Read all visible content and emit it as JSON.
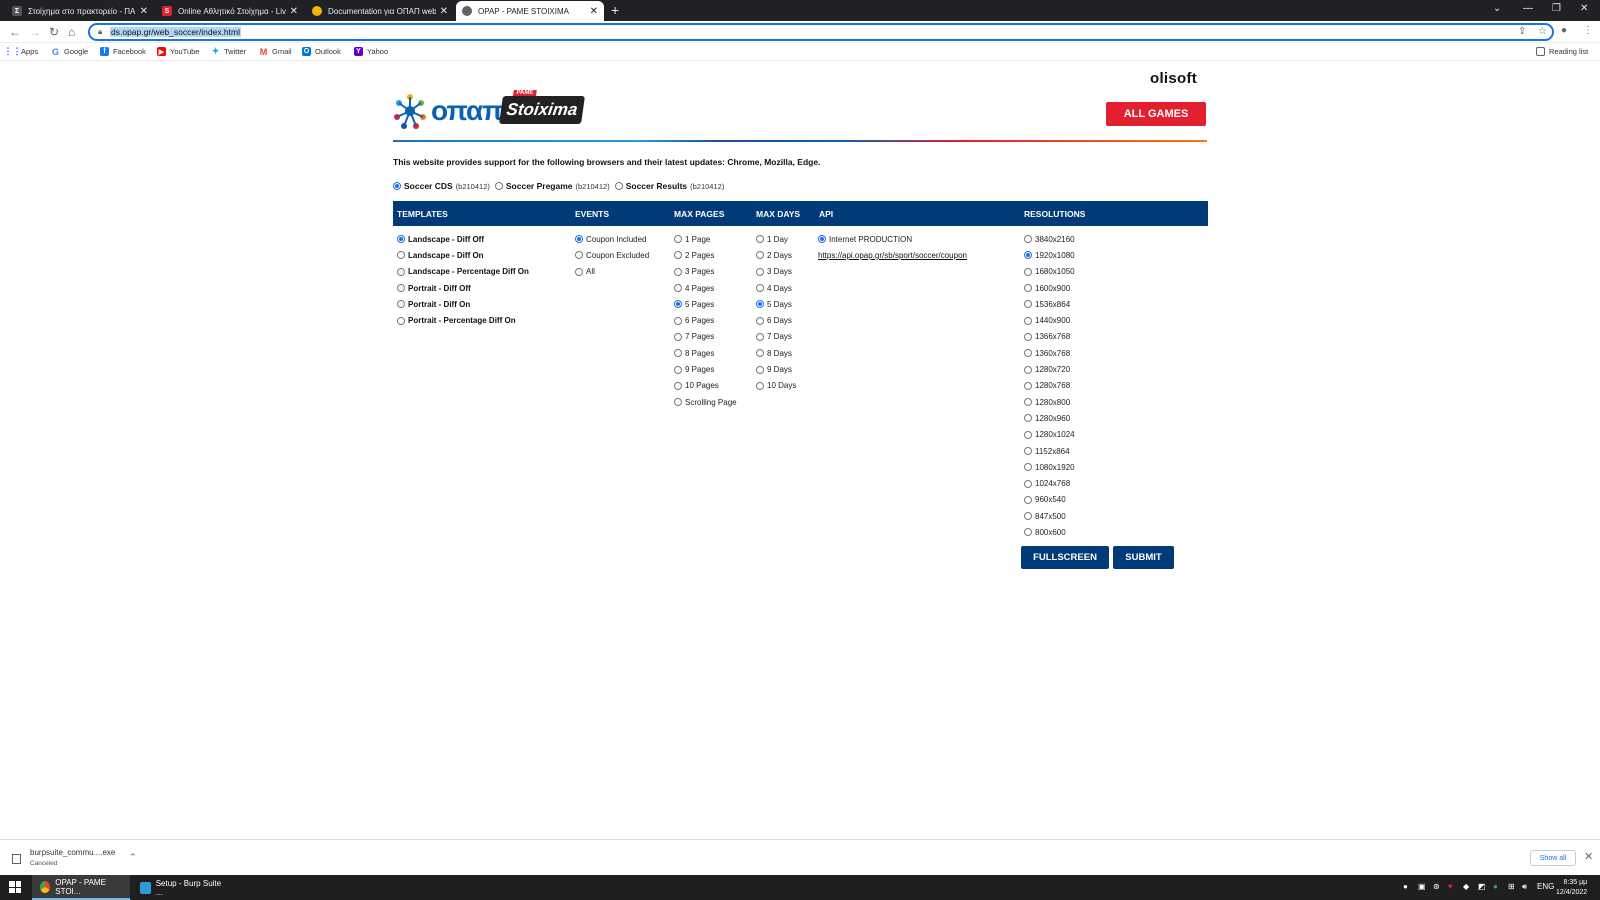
{
  "browser": {
    "tabs": [
      {
        "title": "Στοίχημα στο πρακτορείο - ΠΑΜ",
        "favicon_color": "#555555"
      },
      {
        "title": "Online Αθλητικό Στοίχημα - Live",
        "favicon_color": "#e2202f"
      },
      {
        "title": "Documentation για ΟΠΑΠ web s",
        "favicon_color": "#f6b400"
      },
      {
        "title": "OPAP - PAME STOIXIMA",
        "favicon_color": "#5f6368"
      }
    ],
    "url": "ds.opap.gr/web_soccer/index.html",
    "bookmarks": [
      "Apps",
      "Google",
      "Facebook",
      "YouTube",
      "Twitter",
      "Gmail",
      "Outlook",
      "Yahoo"
    ],
    "reading_list": "Reading list"
  },
  "page": {
    "brand_right": "olisoft",
    "logo_text": "οπαπ",
    "stoixima_text": "Stoixima",
    "stoixima_tag": "PAME",
    "all_games": "ALL GAMES",
    "support_text": "This website provides support for the following browsers and their latest updates: Chrome, Mozilla, Edge.",
    "products": [
      {
        "name": "Soccer CDS",
        "version": "(b210412)",
        "selected": true
      },
      {
        "name": "Soccer Pregame",
        "version": "(b210412)",
        "selected": false
      },
      {
        "name": "Soccer Results",
        "version": "(b210412)",
        "selected": false
      }
    ],
    "headers": {
      "templates": "TEMPLATES",
      "events": "EVENTS",
      "max_pages": "MAX PAGES",
      "max_days": "MAX DAYS",
      "api": "API",
      "resolutions": "RESOLUTIONS"
    },
    "templates": [
      {
        "label": "Landscape - Diff Off",
        "selected": true
      },
      {
        "label": "Landscape - Diff On",
        "selected": false
      },
      {
        "label": "Landscape - Percentage Diff On",
        "selected": false
      },
      {
        "label": "Portrait - Diff Off",
        "selected": false
      },
      {
        "label": "Portrait - Diff On",
        "selected": false
      },
      {
        "label": "Portrait - Percentage Diff On",
        "selected": false
      }
    ],
    "events": [
      {
        "label": "Coupon Included",
        "selected": true
      },
      {
        "label": "Coupon Excluded",
        "selected": false
      },
      {
        "label": "All",
        "selected": false
      }
    ],
    "max_pages": [
      {
        "label": "1 Page",
        "selected": false
      },
      {
        "label": "2 Pages",
        "selected": false
      },
      {
        "label": "3 Pages",
        "selected": false
      },
      {
        "label": "4 Pages",
        "selected": false
      },
      {
        "label": "5 Pages",
        "selected": true
      },
      {
        "label": "6 Pages",
        "selected": false
      },
      {
        "label": "7 Pages",
        "selected": false
      },
      {
        "label": "8 Pages",
        "selected": false
      },
      {
        "label": "9 Pages",
        "selected": false
      },
      {
        "label": "10 Pages",
        "selected": false
      },
      {
        "label": "Scrolling Page",
        "selected": false
      }
    ],
    "max_days": [
      {
        "label": "1 Day",
        "selected": false
      },
      {
        "label": "2 Days",
        "selected": false
      },
      {
        "label": "3 Days",
        "selected": false
      },
      {
        "label": "4 Days",
        "selected": false
      },
      {
        "label": "5 Days",
        "selected": true
      },
      {
        "label": "6 Days",
        "selected": false
      },
      {
        "label": "7 Days",
        "selected": false
      },
      {
        "label": "8 Days",
        "selected": false
      },
      {
        "label": "9 Days",
        "selected": false
      },
      {
        "label": "10 Days",
        "selected": false
      }
    ],
    "api": {
      "label": "Internet PRODUCTION",
      "selected": true,
      "link": "https://api.opap.gr/sb/sport/soccer/coupon"
    },
    "resolutions": [
      {
        "label": "3840x2160",
        "selected": false
      },
      {
        "label": "1920x1080",
        "selected": true
      },
      {
        "label": "1680x1050",
        "selected": false
      },
      {
        "label": "1600x900",
        "selected": false
      },
      {
        "label": "1536x864",
        "selected": false
      },
      {
        "label": "1440x900",
        "selected": false
      },
      {
        "label": "1366x768",
        "selected": false
      },
      {
        "label": "1360x768",
        "selected": false
      },
      {
        "label": "1280x720",
        "selected": false
      },
      {
        "label": "1280x768",
        "selected": false
      },
      {
        "label": "1280x800",
        "selected": false
      },
      {
        "label": "1280x960",
        "selected": false
      },
      {
        "label": "1280x1024",
        "selected": false
      },
      {
        "label": "1152x864",
        "selected": false
      },
      {
        "label": "1080x1920",
        "selected": false
      },
      {
        "label": "1024x768",
        "selected": false
      },
      {
        "label": "960x540",
        "selected": false
      },
      {
        "label": "847x500",
        "selected": false
      },
      {
        "label": "800x600",
        "selected": false
      }
    ],
    "fullscreen": "FULLSCREEN",
    "submit": "SUBMIT"
  },
  "downloads": {
    "file": "burpsuite_commu....exe",
    "status": "Canceled",
    "show_all": "Show all"
  },
  "taskbar": {
    "tasks": [
      {
        "label": "OPAP - PAME STOI...",
        "active": true
      },
      {
        "label": "Setup - Burp Suite ...",
        "active": false
      }
    ],
    "lang": "ENG",
    "time": "8:35 μμ",
    "date": "12/4/2022"
  }
}
